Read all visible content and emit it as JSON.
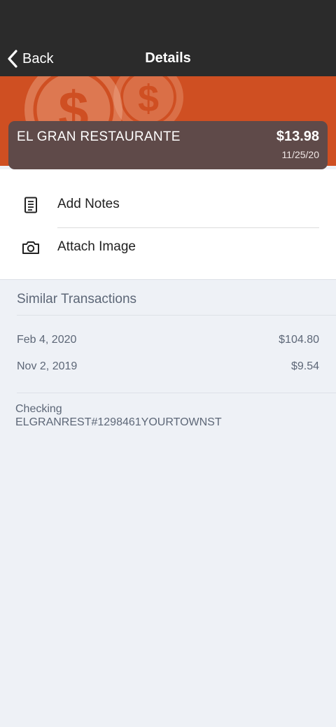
{
  "nav": {
    "back_label": "Back",
    "title": "Details",
    "back_icon": "chevron-left-icon"
  },
  "colors": {
    "navbar": "#2b2b2b",
    "hero": "#cf4f22",
    "card": "#5f4a49",
    "background": "#eef1f6",
    "muted_text": "#5d6777"
  },
  "transaction": {
    "merchant": "EL GRAN RESTAURANTE",
    "amount": "$13.98",
    "date": "11/25/20"
  },
  "actions": [
    {
      "label": "Add Notes",
      "icon": "document-icon"
    },
    {
      "label": "Attach Image",
      "icon": "camera-icon"
    }
  ],
  "similar": {
    "title": "Similar Transactions",
    "items": [
      {
        "date": "Feb 4, 2020",
        "amount": "$104.80"
      },
      {
        "date": "Nov 2, 2019",
        "amount": "$9.54"
      }
    ]
  },
  "account": {
    "type": "Checking",
    "description": "ELGRANREST#1298461YOURTOWNST"
  }
}
